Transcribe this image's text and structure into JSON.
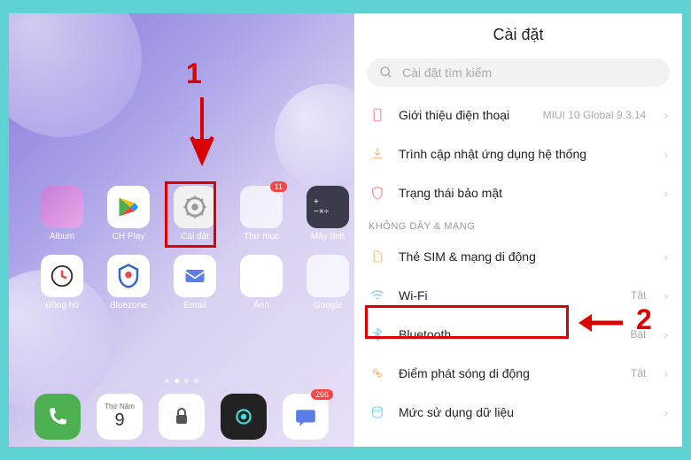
{
  "annotations": {
    "step1": "1",
    "step2": "2"
  },
  "home": {
    "apps": [
      {
        "label": "Album",
        "color": "linear-gradient(135deg,#c77dd8,#e8a8e8)"
      },
      {
        "label": "CH Play",
        "color": "#fff"
      },
      {
        "label": "Cài đặt",
        "color": "#f0f0f0"
      },
      {
        "label": "Thư mục",
        "color": "#fff",
        "badge": "11"
      },
      {
        "label": "Máy tính",
        "color": "#3a3a4a"
      },
      {
        "label": "Đồng hồ",
        "color": "#fff"
      },
      {
        "label": "Bluezone",
        "color": "#fff"
      },
      {
        "label": "Email",
        "color": "#fff"
      },
      {
        "label": "Ảnh",
        "color": "#fff"
      },
      {
        "label": "Google",
        "color": "#fff"
      }
    ],
    "dock": {
      "date_day": "Thứ Năm",
      "date_num": "9",
      "msg_badge": "266"
    }
  },
  "settings": {
    "title": "Cài đặt",
    "search_placeholder": "Cài đặt tìm kiếm",
    "section_wireless": "KHÔNG DÂY & MẠNG",
    "items": {
      "about": {
        "label": "Giới thiệu điện thoại",
        "value": "MIUI 10 Global 9.3.14"
      },
      "update": {
        "label": "Trình cập nhật ứng dụng hệ thống"
      },
      "security": {
        "label": "Trạng thái bảo mật"
      },
      "sim": {
        "label": "Thẻ SIM & mạng di động"
      },
      "wifi": {
        "label": "Wi-Fi",
        "value": "Tắt"
      },
      "bluetooth": {
        "label": "Bluetooth",
        "value": "Bật"
      },
      "hotspot": {
        "label": "Điểm phát sóng di động",
        "value": "Tắt"
      },
      "data": {
        "label": "Mức sử dụng dữ liệu"
      }
    }
  }
}
